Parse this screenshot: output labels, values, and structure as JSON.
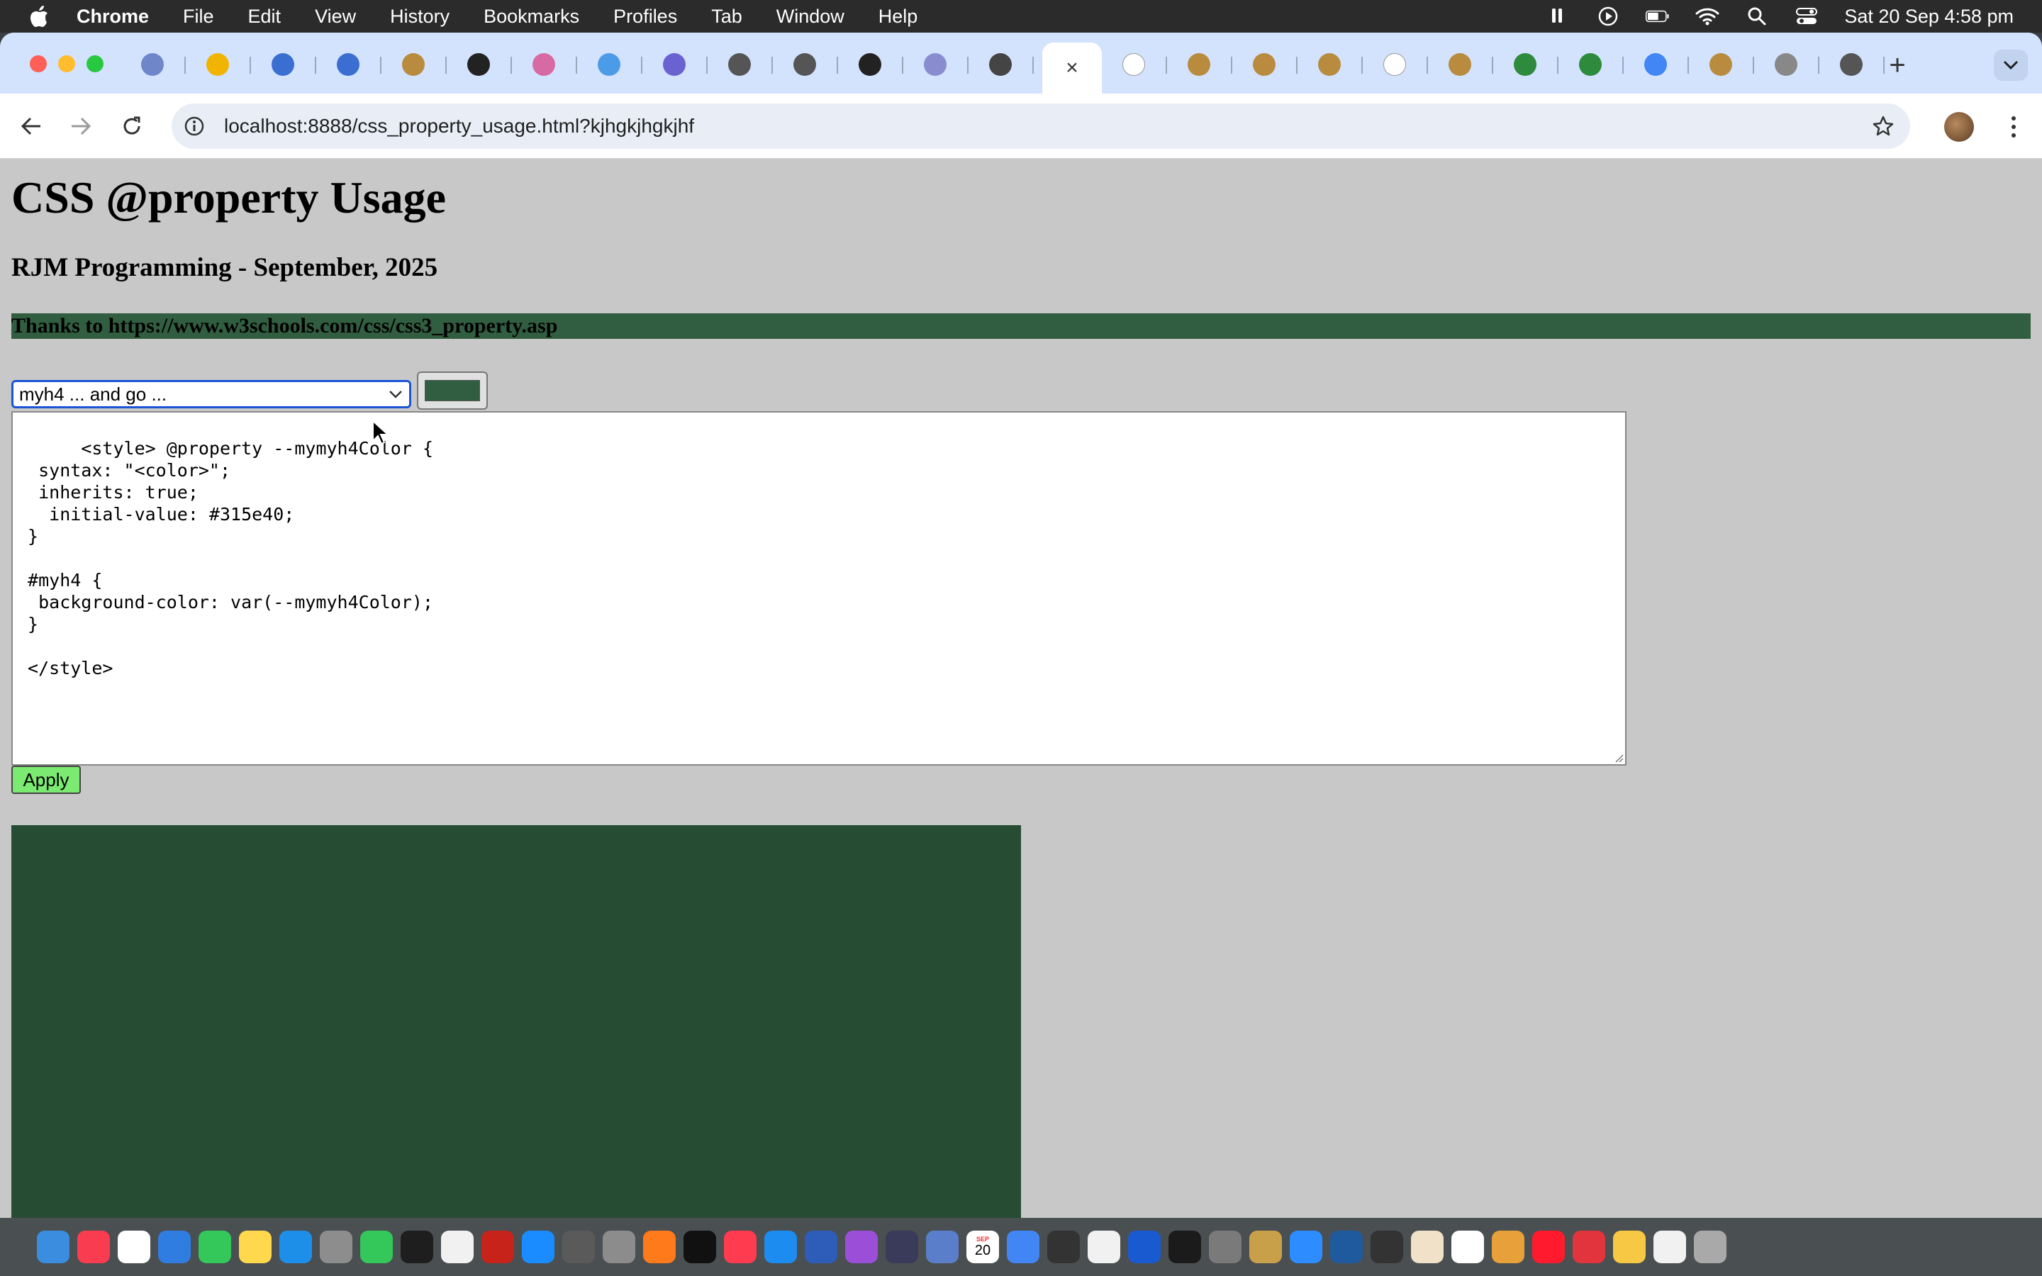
{
  "menubar": {
    "app_name": "Chrome",
    "items": [
      "File",
      "Edit",
      "View",
      "History",
      "Bookmarks",
      "Profiles",
      "Tab",
      "Window",
      "Help"
    ],
    "datetime": "Sat 20 Sep  4:58 pm"
  },
  "tabs": {
    "favicons": [
      "#6f87c9",
      "#f1b400",
      "#3a6fd1",
      "#3a6fd1",
      "#b88b3f",
      "#222",
      "#d86aa3",
      "#4c9be8",
      "#6b62d2",
      "#555",
      "#555",
      "#222",
      "#8a8cd0",
      "#444",
      "#fff",
      "#b88b3f",
      "#b88b3f",
      "#b88b3f",
      "#fff",
      "#b88b3f",
      "#2e8a3c",
      "#2e8a3c",
      "#4285f4",
      "#b88b3f",
      "#888",
      "#555"
    ],
    "active_close": "×",
    "new_tab": "+"
  },
  "toolbar": {
    "url": "localhost:8888/css_property_usage.html?kjhgkjhgkjhf"
  },
  "page": {
    "title": "CSS @property Usage",
    "subtitle": "RJM Programming - September, 2025",
    "thanks": "Thanks to https://www.w3schools.com/css/css3_property.asp",
    "select_value": "myh4 ... and go ...",
    "color_value": "#315e40",
    "code": "<style> @property --mymyh4Color {\n  syntax: \"<color>\";\n  inherits: true;\n   initial-value: #315e40;\n }\n\n #myh4 {\n  background-color: var(--mymyh4Color);\n }\n\n </style>",
    "apply_label": "Apply",
    "accent": "#315e40"
  },
  "dock": {
    "apps": [
      "Finder",
      "Music",
      "Reminders",
      "Mail",
      "Messages",
      "Notes",
      "Freeform",
      "Launchpad",
      "FaceTime",
      "Terminal",
      "TextEdit",
      "FileZilla",
      "App Store",
      "Calculator",
      "Preview",
      "Firefox",
      "TV",
      "News",
      "Safari",
      "Bluetooth",
      "Podcasts",
      "Script",
      "Maps",
      "Calendar",
      "Chrome",
      "Console",
      "Files",
      "QuickTime",
      "IntelliJ",
      "Settings",
      "Compressor",
      "Zoom",
      "Vectorworks",
      "Inkscape",
      "TablePlus",
      "Pencil",
      "Sequel",
      "Opera",
      "Spark",
      "Lightbulb",
      "Files",
      "Trash"
    ],
    "calendar_month": "SEP",
    "calendar_day": "20"
  }
}
